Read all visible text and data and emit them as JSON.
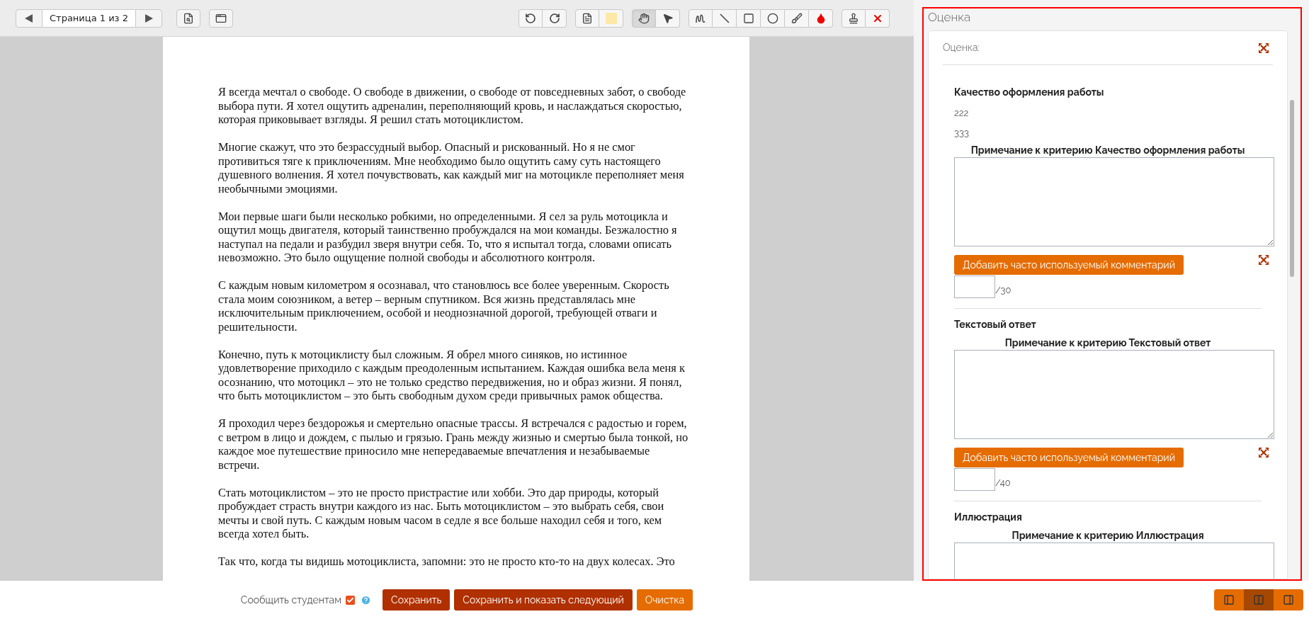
{
  "toolbar": {
    "page_label": "Страница 1 из 2",
    "tool_groups": [
      [
        {
          "kind": "rotate-left",
          "selected": false
        },
        {
          "kind": "rotate-right",
          "selected": false
        }
      ],
      [
        {
          "kind": "text-note",
          "selected": false
        },
        {
          "kind": "highlight",
          "selected": false
        }
      ],
      [
        {
          "kind": "hand",
          "selected": true
        },
        {
          "kind": "pointer",
          "selected": false
        }
      ],
      [
        {
          "kind": "freehand",
          "selected": false
        },
        {
          "kind": "line",
          "selected": false
        },
        {
          "kind": "rectangle",
          "selected": false
        },
        {
          "kind": "oval",
          "selected": false
        },
        {
          "kind": "brush",
          "selected": false
        },
        {
          "kind": "color",
          "selected": false
        }
      ],
      [
        {
          "kind": "stamp",
          "selected": false
        },
        {
          "kind": "delete",
          "selected": false
        }
      ]
    ]
  },
  "document": {
    "paragraphs": [
      "Я всегда мечтал о свободе. О свободе в движении, о свободе от повседневных забот, о свободе выбора пути. Я хотел ощутить адреналин, переполняющий кровь, и наслаждаться скоростью, которая приковывает взгляды. Я решил стать мотоциклистом.",
      "Многие скажут, что это безрассудный выбор. Опасный и рискованный. Но я не смог противиться тяге к приключениям. Мне необходимо было ощутить саму суть настоящего душевного волнения. Я хотел почувствовать, как каждый миг на мотоцикле переполняет меня необычными эмоциями.",
      "Мои первые шаги были несколько робкими, но определенными. Я сел за руль мотоцикла и ощутил мощь двигателя, который таинственно пробуждался на мои команды. Безжалостно я наступал на педали и разбудил зверя внутри себя. То, что я испытал тогда, словами описать невозможно. Это было ощущение полной свободы и абсолютного контроля.",
      "С каждым новым километром я осознавал, что становлюсь все более уверенным. Скорость стала моим союзником, а ветер – верным спутником. Вся жизнь представлялась мне исключительным приключением, особой и неоднозначной дорогой, требующей отваги и решительности.",
      "Конечно, путь к мотоциклисту был сложным. Я обрел много синяков, но истинное удовлетворение приходило с каждым преодоленным испытанием. Каждая ошибка вела меня к осознанию, что мотоцикл – это не только средство передвижения, но и образ жизни. Я понял, что быть мотоциклистом – это быть свободным духом среди привычных рамок общества.",
      "Я проходил через бездорожья и смертельно опасные трассы. Я встречался с радостью и горем, с ветром в лицо и дождем, с пылью и грязью. Грань между жизнью и смертью была тонкой, но каждое мое путешествие приносило мне непередаваемые впечатления и незабываемые встречи.",
      "Стать мотоциклистом – это не просто пристрастие или хобби. Это дар природы, который пробуждает страсть внутри каждого из нас. Быть мотоциклистом – это выбрать себя, свои мечты и свой путь. С каждым новым часом в седле я все больше находил себя и того, кем всегда хотел быть.",
      "Так что, когда ты видишь мотоциклиста, запомни: это не просто кто-то на двух колесах. Это"
    ]
  },
  "grading": {
    "title": "Оценка",
    "card_label": "Оценка:",
    "criteria": [
      {
        "name": "Качество оформления работы",
        "values": [
          "222",
          "333"
        ],
        "note_label": "Примечание к критерию Качество оформления работы",
        "comment_button": "Добавить часто используемый комментарий",
        "max_score": "/30"
      },
      {
        "name": "Текстовый ответ",
        "note_label": "Примечание к критерию Текстовый ответ",
        "comment_button": "Добавить часто используемый комментарий",
        "max_score": "/40"
      },
      {
        "name": "Иллюстрация",
        "note_label": "Примечание к критерию Иллюстрация"
      }
    ]
  },
  "footer": {
    "notify_label": "Сообщить студентам",
    "notify_checked": true,
    "buttons": [
      {
        "label": "Сохранить",
        "kind": "primary"
      },
      {
        "label": "Сохранить и показать следующий",
        "kind": "primary"
      },
      {
        "label": "Очистка",
        "kind": "secondary"
      }
    ],
    "layouts": [
      {
        "kind": "left",
        "selected": false
      },
      {
        "kind": "both",
        "selected": true
      },
      {
        "kind": "right",
        "selected": false
      }
    ]
  }
}
